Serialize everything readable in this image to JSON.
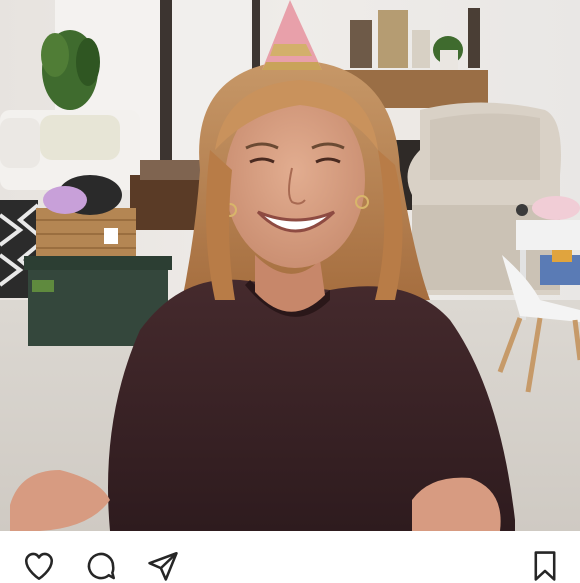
{
  "post": {
    "photo": {
      "subject": "photo",
      "colors": {
        "wall": "#ece9e6",
        "floor": "#d9d5cf",
        "hair": "#c08a52",
        "skin": "#d9a184",
        "sweater": "#3b2226",
        "hat": "#e8a0aa",
        "hat_band": "#c9a35a",
        "shelf": "#9a6e45",
        "armchair": "#d9d1c6",
        "storage_box": "#34473c",
        "basket": "#b58a55"
      }
    },
    "actions": [
      {
        "id": "like",
        "icon": "heart-icon"
      },
      {
        "id": "comment",
        "icon": "comment-icon"
      },
      {
        "id": "share",
        "icon": "paper-plane-icon"
      },
      {
        "id": "save",
        "icon": "bookmark-icon"
      }
    ],
    "icon_color": "#262626"
  }
}
